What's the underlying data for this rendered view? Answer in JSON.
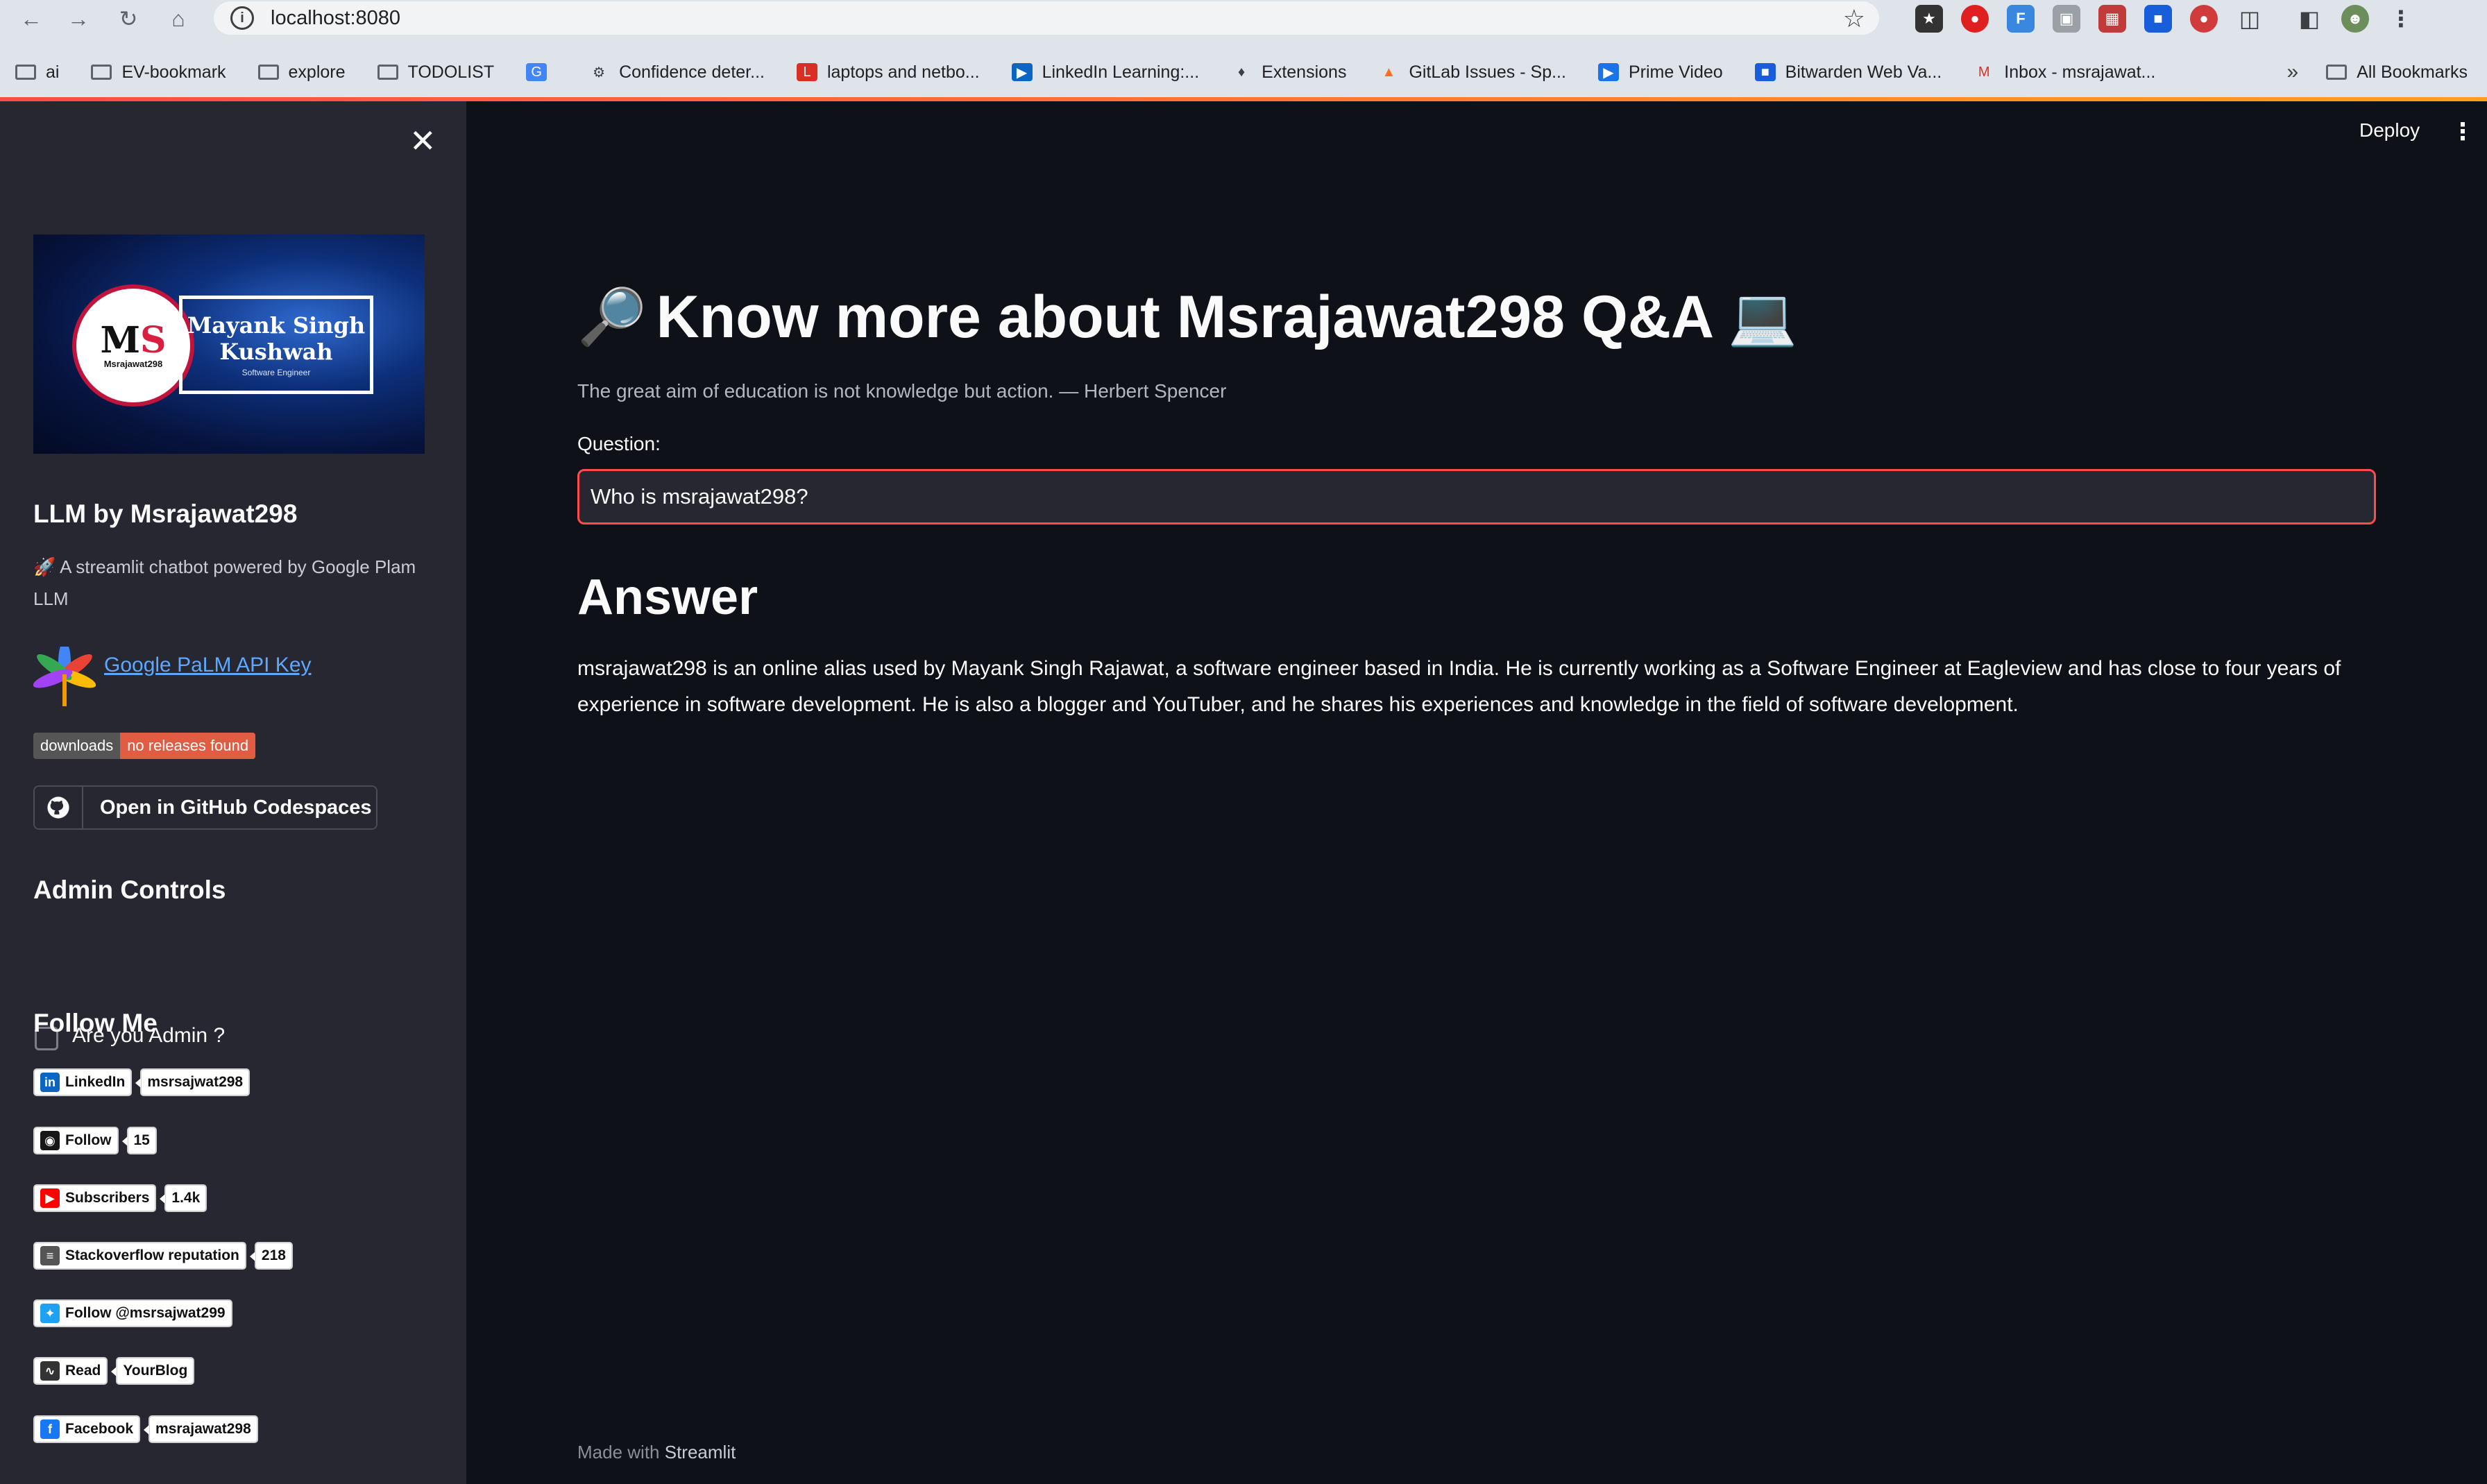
{
  "browser": {
    "url": "localhost:8080",
    "bookmarks": [
      {
        "label": "ai",
        "icon": "folder-icon"
      },
      {
        "label": "EV-bookmark",
        "icon": "folder-icon"
      },
      {
        "label": "explore",
        "icon": "folder-icon"
      },
      {
        "label": "TODOLIST",
        "icon": "folder-icon"
      },
      {
        "label": "",
        "icon": "translate-icon"
      },
      {
        "label": "Confidence deter...",
        "icon": "globe-icon"
      },
      {
        "label": "laptops and netbo...",
        "icon": "l-logo-icon"
      },
      {
        "label": "LinkedIn Learning:...",
        "icon": "linkedin-learning-icon"
      },
      {
        "label": "Extensions",
        "icon": "puzzle-icon"
      },
      {
        "label": "GitLab Issues - Sp...",
        "icon": "gitlab-icon"
      },
      {
        "label": "Prime Video",
        "icon": "prime-video-icon"
      },
      {
        "label": "Bitwarden Web Va...",
        "icon": "bitwarden-icon"
      },
      {
        "label": "Inbox - msrajawat...",
        "icon": "gmail-icon"
      }
    ],
    "all_bookmarks": "All Bookmarks"
  },
  "sidebar": {
    "banner": {
      "logo_letters": "MS",
      "logo_sub": "Msrajawat298",
      "name": "Mayank Singh Kushwah",
      "role": "Software Engineer"
    },
    "title": "LLM by Msrajawat298",
    "description": "🚀 A streamlit chatbot powered by Google Plam LLM",
    "api_link": "Google PaLM API Key",
    "downloads_badge": {
      "label": "downloads",
      "value": "no releases found"
    },
    "codespaces_button": "Open in GitHub Codespaces",
    "admin_heading": "Admin Controls",
    "admin_checkbox": "Are you Admin ?",
    "follow_heading": "Follow Me",
    "badges": [
      {
        "label": "LinkedIn",
        "value": "msrsajwat298",
        "icon": "linkedin-icon",
        "color": "#0a66c2"
      },
      {
        "label": "Follow",
        "value": "15",
        "icon": "github-icon",
        "color": "#181717"
      },
      {
        "label": "Subscribers",
        "value": "1.4k",
        "icon": "youtube-icon",
        "color": "#ff0000"
      },
      {
        "label": "Stackoverflow reputation",
        "value": "218",
        "icon": "stackoverflow-icon",
        "color": "#555555"
      },
      {
        "label": "Follow @msrsajwat299",
        "value": "",
        "icon": "twitter-icon",
        "color": "#1da1f2"
      },
      {
        "label": "Read",
        "value": "YourBlog",
        "icon": "rss-icon",
        "color": "#333333"
      },
      {
        "label": "Facebook",
        "value": "msrajawat298",
        "icon": "facebook-icon",
        "color": "#1877f2"
      }
    ]
  },
  "main": {
    "deploy": "Deploy",
    "title_icon_left": "🔎",
    "title": "Know more about Msrajawat298 Q&A",
    "title_icon_right": "💻",
    "caption": "The great aim of education is not knowledge but action. — Herbert Spencer",
    "question_label": "Question:",
    "question_value": "Who is msrajawat298?",
    "answer_heading": "Answer",
    "answer_text": "msrajawat298 is an online alias used by Mayank Singh Rajawat, a software engineer based in India. He is currently working as a Software Engineer at Eagleview and has close to four years of experience in software development. He is also a blogger and YouTuber, and he shares his experiences and knowledge in the field of software development.",
    "footer_prefix": "Made with",
    "footer_brand": "Streamlit"
  },
  "colors": {
    "accent": "#ff4b4b",
    "link": "#5ea7ff",
    "sidebar_bg": "#262730",
    "main_bg": "#0e1117"
  }
}
